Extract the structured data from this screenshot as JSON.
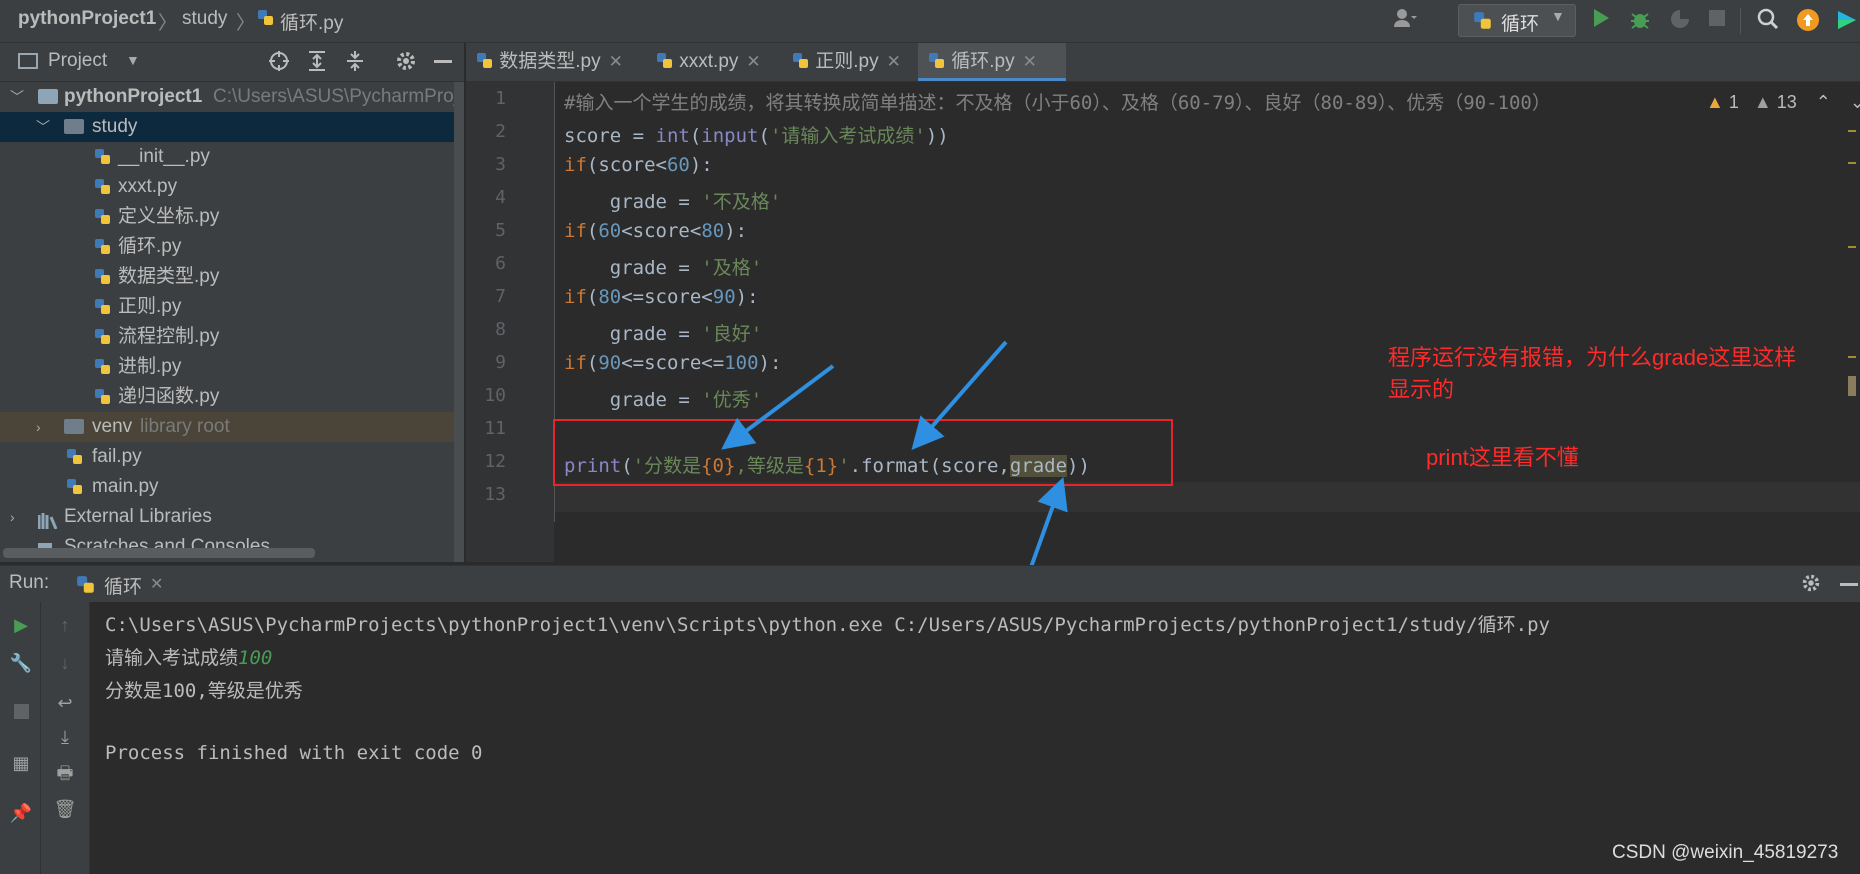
{
  "breadcrumb": {
    "project": "pythonProject1",
    "folder": "study",
    "file": "循环.py"
  },
  "toolbar": {
    "run_config": "循环"
  },
  "project_panel": {
    "title": "Project",
    "root_name": "pythonProject1",
    "root_path": "C:\\Users\\ASUS\\PycharmProjec",
    "study_folder": "study",
    "study_files": [
      "__init__.py",
      "xxxt.py",
      "定义坐标.py",
      "循环.py",
      "数据类型.py",
      "正则.py",
      "流程控制.py",
      "进制.py",
      "递归函数.py"
    ],
    "venv": "venv",
    "venv_hint": "library root",
    "root_files": [
      "fail.py",
      "main.py"
    ],
    "external": "External Libraries",
    "scratches": "Scratches and Consoles"
  },
  "tabs": [
    "数据类型.py",
    "xxxt.py",
    "正则.py",
    "循环.py"
  ],
  "editor": {
    "warnings": {
      "warn_count": "1",
      "weak_count": "13"
    },
    "line_numbers": [
      "1",
      "2",
      "3",
      "4",
      "5",
      "6",
      "7",
      "8",
      "9",
      "10",
      "11",
      "12",
      "13"
    ],
    "comment": "#输入一个学生的成绩，将其转换成简单描述：不及格（小于60）、及格（60-79）、良好（80-89）、优秀（90-100）",
    "line2": {
      "a": "score = ",
      "fn1": "int",
      "b": "(",
      "fn2": "input",
      "c": "(",
      "s": "'请输入考试成绩'",
      "d": "))"
    },
    "if1": {
      "kw": "if",
      "a": "(score<",
      "n": "60",
      "b": "):"
    },
    "g1": {
      "a": "    grade = ",
      "s": "'不及格'"
    },
    "if2": {
      "kw": "if",
      "a": "(",
      "n1": "60",
      "b": "<score<",
      "n2": "80",
      "c": "):"
    },
    "g2": {
      "a": "    grade = ",
      "s": "'及格'"
    },
    "if3": {
      "kw": "if",
      "a": "(",
      "n1": "80",
      "b": "<=score<",
      "n2": "90",
      "c": "):"
    },
    "g3": {
      "a": "    grade = ",
      "s": "'良好'"
    },
    "if4": {
      "kw": "if",
      "a": "(",
      "n1": "90",
      "b": "<=score<=",
      "n2": "100",
      "c": "):"
    },
    "g4": {
      "a": "    grade = ",
      "s": "'优秀'"
    },
    "print": {
      "fn": "print",
      "a": "(",
      "s1": "'分数是",
      "f1": "{0}",
      "s2": ",等级是",
      "f2": "{1}",
      "s3": "'",
      "b": ".format(score",
      "c": ",",
      "d": "grade",
      "e": "))"
    }
  },
  "annotations": {
    "note1": "程序运行没有报错，为什么grade这里这样",
    "note1b": "显示的",
    "note2": "print这里看不懂"
  },
  "run": {
    "label": "Run:",
    "tab": "循环",
    "cmd": "C:\\Users\\ASUS\\PycharmProjects\\pythonProject1\\venv\\Scripts\\python.exe C:/Users/ASUS/PycharmProjects/pythonProject1/study/循环.py",
    "prompt": "请输入考试成绩",
    "input_value": "100",
    "result": "分数是100,等级是优秀",
    "finished": "Process finished with exit code 0"
  },
  "watermark": "CSDN @weixin_45819273",
  "colors": {
    "annotation_red": "#ff2a2a",
    "arrow_blue": "#2f8fe0",
    "keyword": "#cc7832",
    "string": "#6a8759",
    "number": "#6897bb"
  }
}
